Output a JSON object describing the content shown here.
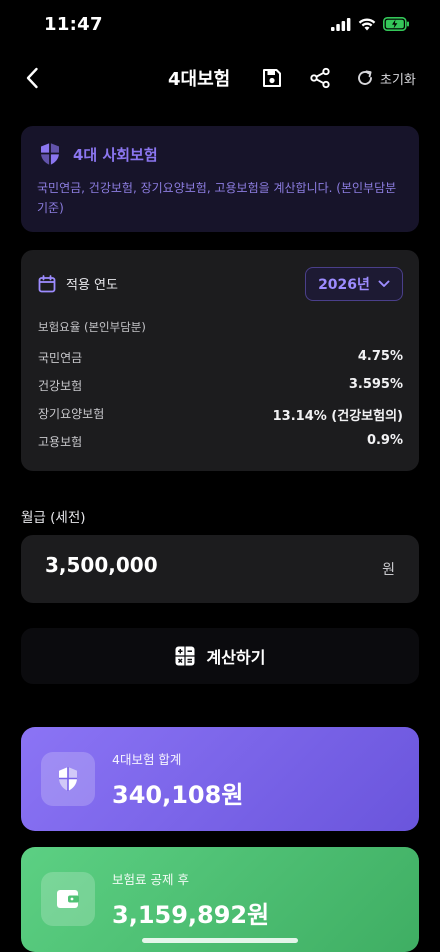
{
  "status": {
    "time": "11:47"
  },
  "nav": {
    "title": "4대보험",
    "reset_label": "초기화"
  },
  "info": {
    "title": "4대 사회보험",
    "description": "국민연금, 건강보험, 장기요양보험, 고용보험을 계산합니다. (본인부담분 기준)"
  },
  "rates": {
    "year_label": "적용 연도",
    "year_value": "2026년",
    "subtitle": "보험요율 (본인부담분)",
    "items": [
      {
        "name": "국민연금",
        "value": "4.75%"
      },
      {
        "name": "건강보험",
        "value": "3.595%"
      },
      {
        "name": "장기요양보험",
        "value": "13.14% (건강보험의)"
      },
      {
        "name": "고용보험",
        "value": "0.9%"
      }
    ]
  },
  "salary": {
    "label": "월급 (세전)",
    "value": "3,500,000",
    "unit": "원"
  },
  "calculate": {
    "label": "계산하기"
  },
  "results": {
    "total_label": "4대보험 합계",
    "total_value": "340,108원",
    "net_label": "보험료 공제 후",
    "net_value": "3,159,892원"
  },
  "colors": {
    "accent": "#8b76f0",
    "total_card": "#7a64ea",
    "net_card": "#4fc274",
    "battery": "#34c759"
  },
  "icons": [
    "back-icon",
    "save-icon",
    "share-icon",
    "reset-icon",
    "shield-icon",
    "calendar-icon",
    "chevron-down-icon",
    "calculator-icon",
    "wallet-icon"
  ]
}
